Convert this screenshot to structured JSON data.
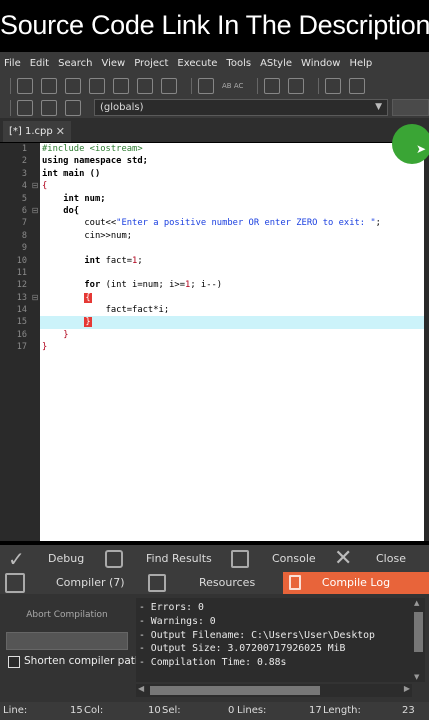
{
  "banner": {
    "text": "Source Code Link In The Description"
  },
  "menu": [
    "File",
    "Edit",
    "Search",
    "View",
    "Project",
    "Execute",
    "Tools",
    "AStyle",
    "Window",
    "Help"
  ],
  "toolbar": {
    "compare_label": "AB AC"
  },
  "scope": {
    "value": "(globals)"
  },
  "file_tab": {
    "label": "[*] 1.cpp",
    "close": "✕"
  },
  "line_numbers": [
    "1",
    "2",
    "3",
    "4",
    "5",
    "6",
    "7",
    "8",
    "9",
    "10",
    "11",
    "12",
    "13",
    "14",
    "15",
    "16",
    "17"
  ],
  "code": {
    "l1": "#include <iostream>",
    "l2": "using namespace std;",
    "l3": "int main ()",
    "l4": "{",
    "l5_indent": "    ",
    "l5": "int num;",
    "l6_indent": "    ",
    "l6": "do{",
    "l7_indent": "        ",
    "l7_fn": "cout<<",
    "l7_str": "\"Enter a positive number OR enter ZERO to exit: \"",
    "l7_end": ";",
    "l8_indent": "        ",
    "l8": "cin>>num;",
    "l9": "",
    "l10_indent": "        ",
    "l10_kw": "int ",
    "l10_a": "fact=",
    "l10_n": "1",
    "l10_end": ";",
    "l11": "",
    "l12_indent": "        ",
    "l12_kw": "for ",
    "l12_a": "(int i=num; i>=",
    "l12_n": "1",
    "l12_b": "; i--)",
    "l13_indent": "        ",
    "l13": "{",
    "l14_indent": "            ",
    "l14": "fact=fact*i;",
    "l15_indent": "        ",
    "l15": "}",
    "l16_indent": "    ",
    "l16": "}",
    "l17": "}"
  },
  "panel_tabs": {
    "debug": "Debug",
    "find_results": "Find Results",
    "console": "Console",
    "close": "Close",
    "compiler": "Compiler (7)",
    "resources": "Resources",
    "compile_log": "Compile Log"
  },
  "compile": {
    "abort_label": "Abort Compilation",
    "shorten_label": "Shorten compiler path",
    "log": [
      "- Errors: 0",
      "- Warnings: 0",
      "- Output Filename: C:\\Users\\User\\Desktop",
      "- Output Size: 3.07200717926025 MiB",
      "- Compilation Time: 0.88s"
    ]
  },
  "status": {
    "line": "Line:",
    "line_val": "15",
    "col": "Col:",
    "col_val": "10",
    "sel": "Sel:",
    "sel_val": "0",
    "lines": "Lines:",
    "lines_val": "17",
    "length": "Length:",
    "length_val": "23"
  },
  "colors": {
    "accent": "#e8643a",
    "highlight_line": "#ccf3fa",
    "cursor_circle": "#3aa535"
  }
}
